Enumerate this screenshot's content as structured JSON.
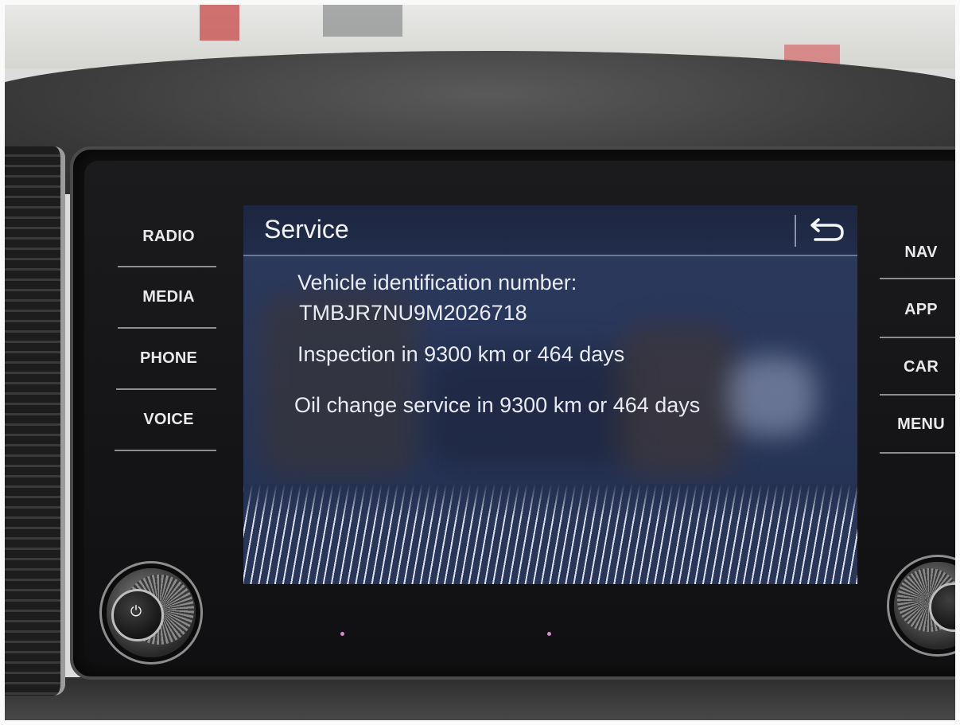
{
  "left_buttons": [
    {
      "label": "RADIO"
    },
    {
      "label": "MEDIA"
    },
    {
      "label": "PHONE"
    },
    {
      "label": "VOICE"
    }
  ],
  "right_buttons": [
    {
      "label": "NAV"
    },
    {
      "label": "APP"
    },
    {
      "label": "CAR"
    },
    {
      "label": "MENU"
    }
  ],
  "screen": {
    "title": "Service",
    "back_icon": "return-arrow-icon",
    "vin_label": "Vehicle identification number:",
    "vin_value": "TMBJR7NU9M2026718",
    "inspection": "Inspection in 9300 km or 464 days",
    "oil_change": "Oil change service in 9300 km or 464 days"
  },
  "knobs": {
    "left_icon": "power-icon",
    "right_icon": "volume-knob-icon"
  },
  "colors": {
    "screen_bg": "#29365a",
    "header_bg": "#1c2640",
    "text": "#e8ebf2",
    "button_text": "#e9e9ea"
  }
}
